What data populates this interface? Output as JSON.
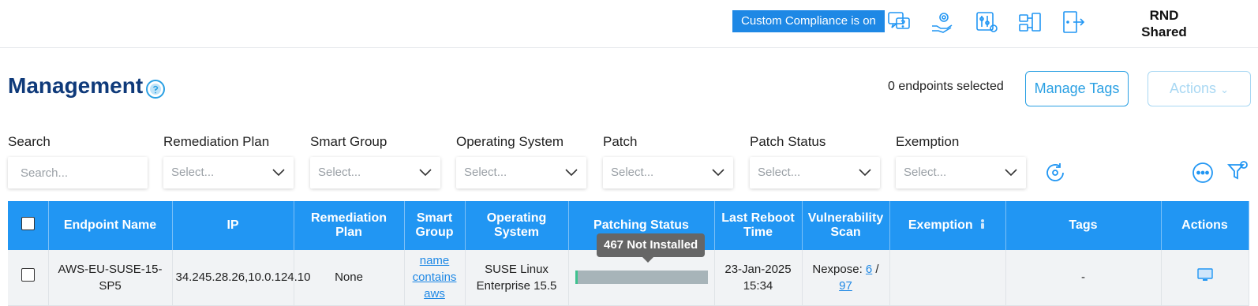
{
  "topbar": {
    "compliance_badge": "Custom Compliance is on",
    "icons": [
      "help-chat-icon",
      "settings-hand-icon",
      "sliders-gear-icon",
      "network-icon",
      "logout-icon"
    ],
    "account_line1": "RND",
    "account_line2": "Shared"
  },
  "header": {
    "title": "Management",
    "selected_count": "0 endpoints selected",
    "manage_tags_label": "Manage Tags",
    "actions_label": "Actions"
  },
  "filters": {
    "search": {
      "label": "Search",
      "placeholder": "Search..."
    },
    "remediation_plan": {
      "label": "Remediation Plan",
      "placeholder": "Select..."
    },
    "smart_group": {
      "label": "Smart Group",
      "placeholder": "Select..."
    },
    "operating_system": {
      "label": "Operating System",
      "placeholder": "Select..."
    },
    "patch": {
      "label": "Patch",
      "placeholder": "Select..."
    },
    "patch_status": {
      "label": "Patch Status",
      "placeholder": "Select..."
    },
    "exemption": {
      "label": "Exemption",
      "placeholder": "Select..."
    }
  },
  "table": {
    "headers": {
      "endpoint_name": "Endpoint Name",
      "ip": "IP",
      "remediation_plan": "Remediation Plan",
      "smart_group": "Smart Group",
      "operating_system": "Operating System",
      "patching_status": "Patching Status",
      "last_reboot_time": "Last Reboot Time",
      "vulnerability_scan": "Vulnerability Scan",
      "exemption": "Exemption",
      "tags": "Tags",
      "actions": "Actions"
    },
    "rows": [
      {
        "endpoint_name": "AWS-EU-SUSE-15-SP5",
        "ip": "34.245.28.26,10.0.124.10",
        "remediation_plan": "None",
        "smart_group": "name contains aws",
        "operating_system": "SUSE Linux Enterprise 15.5",
        "patching_progress": 0.02,
        "last_reboot_time": "23-Jan-2025 15:34",
        "vuln_prefix": "Nexpose: ",
        "vuln_count": "6",
        "vuln_sep": " / ",
        "vuln_total": "97",
        "exemption": "",
        "tags": "-"
      }
    ],
    "tooltip": "467 Not Installed"
  },
  "colors": {
    "accent": "#2196f3",
    "title": "#0f3a7a",
    "installed": "#3ec28f",
    "not_installed": "#a7b4b9"
  }
}
